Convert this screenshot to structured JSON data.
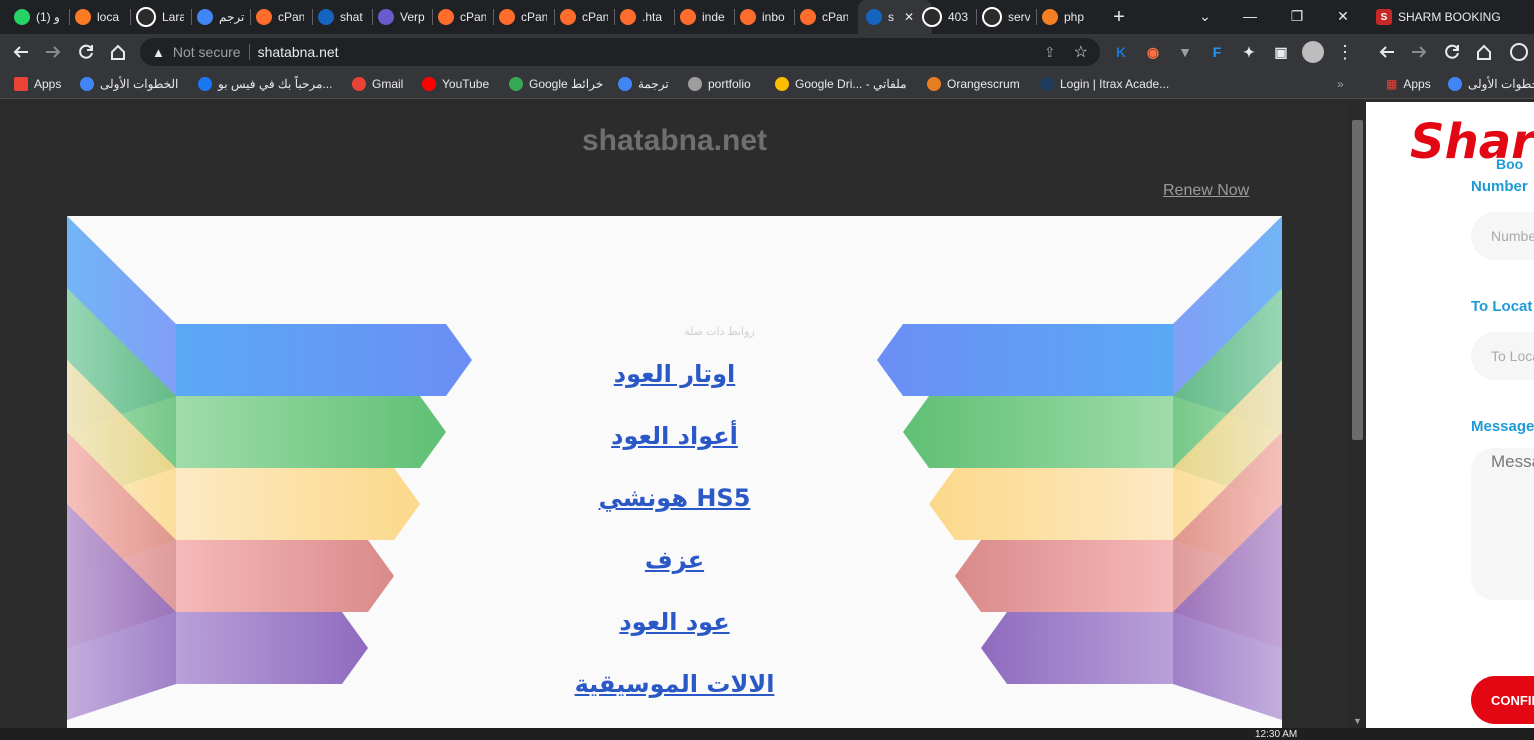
{
  "browser": {
    "tabs": [
      {
        "label": "(1) و",
        "icon": "whatsapp-icon",
        "color": "#25d366"
      },
      {
        "label": "loca",
        "icon": "xampp-icon",
        "color": "#fb7a24"
      },
      {
        "label": "Lara",
        "icon": "globe-icon",
        "color": "#ffffff"
      },
      {
        "label": "ترجم",
        "icon": "google-translate-icon",
        "color": "#4285f4"
      },
      {
        "label": "cPan",
        "icon": "cpanel-icon",
        "color": "#ff6c2c"
      },
      {
        "label": "shat",
        "icon": "s-logo-icon",
        "color": "#1565c0"
      },
      {
        "label": "Verp",
        "icon": "v-logo-icon",
        "color": "#6a5acd"
      },
      {
        "label": "cPan",
        "icon": "cpanel-icon",
        "color": "#ff6c2c"
      },
      {
        "label": "cPan",
        "icon": "cpanel-icon",
        "color": "#ff6c2c"
      },
      {
        "label": "cPan",
        "icon": "cpanel-icon",
        "color": "#ff6c2c"
      },
      {
        "label": ".hta",
        "icon": "cpanel-icon",
        "color": "#ff6c2c"
      },
      {
        "label": "inde",
        "icon": "cpanel-icon",
        "color": "#ff6c2c"
      },
      {
        "label": "inbo",
        "icon": "cpanel-icon",
        "color": "#ff6c2c"
      },
      {
        "label": "cPan",
        "icon": "cpanel-icon",
        "color": "#ff6c2c"
      },
      {
        "label": "s",
        "icon": "s-logo-icon",
        "color": "#1565c0",
        "active": true
      },
      {
        "label": "403",
        "icon": "globe-icon",
        "color": "#ffffff"
      },
      {
        "label": "serv",
        "icon": "google-icon",
        "color": "#ffffff"
      },
      {
        "label": "php",
        "icon": "stackoverflow-icon",
        "color": "#f48024"
      }
    ],
    "new_tab": "+",
    "window_controls": {
      "dropdown": "⌄",
      "minimize": "—",
      "restore": "❐",
      "close": "✕"
    },
    "security_label": "Not secure",
    "url": "shatabna.net",
    "extensions": [
      "K",
      "◉",
      "▼",
      "F",
      "✦",
      "▣"
    ],
    "bookmarks": [
      {
        "label": "Apps",
        "icon": "apps-grid-icon"
      },
      {
        "label": "الخطوات الأولى",
        "icon": "chrome-icon"
      },
      {
        "label": "مرحباً بك في فيس بو...",
        "icon": "facebook-icon"
      },
      {
        "label": "Gmail",
        "icon": "gmail-icon"
      },
      {
        "label": "YouTube",
        "icon": "youtube-icon"
      },
      {
        "label": "Google خرائط",
        "icon": "google-maps-icon"
      },
      {
        "label": "ترجمة",
        "icon": "google-translate-icon"
      },
      {
        "label": "portfolio",
        "icon": "wordpress-icon"
      },
      {
        "label": "Google Dri... - ملفاتي",
        "icon": "google-drive-icon"
      },
      {
        "label": "Orangescrum",
        "icon": "orangescrum-icon"
      },
      {
        "label": "Login | Itrax Acade...",
        "icon": "itrax-icon"
      }
    ],
    "bookmarks_overflow": "»"
  },
  "page": {
    "site_name": "shatabna.net",
    "renew_label": "Renew Now",
    "related_label": "روابط ذات صلة",
    "links": [
      "اوتار العود",
      "أعواد العود",
      "هونشي HS5",
      "عزف",
      "عود العود",
      "الالات الموسيقية"
    ],
    "arrow_colors": [
      [
        "#5aa9f5",
        "#6b8ef5"
      ],
      [
        "#9fdcaa",
        "#5fbf74"
      ],
      [
        "#fde9c4",
        "#fbd98a"
      ],
      [
        "#f6b9b9",
        "#d98a8a"
      ],
      [
        "#b9a0d9",
        "#8f6bbf"
      ]
    ]
  },
  "taskbar": {
    "time": "12:30 AM"
  },
  "second_window": {
    "tab_title": "SHARM BOOKING",
    "bookmarks": [
      {
        "label": "Apps"
      },
      {
        "label": "الخطوات الأولى"
      }
    ],
    "logo_text": "Shar",
    "logo_sub": "Boo",
    "fields": [
      {
        "label": "Number",
        "placeholder": "Numbe"
      },
      {
        "label": "To Locat",
        "placeholder": "To Loca"
      },
      {
        "label": "Message",
        "placeholder": "Messa"
      }
    ],
    "confirm_label": "CONFIR"
  }
}
